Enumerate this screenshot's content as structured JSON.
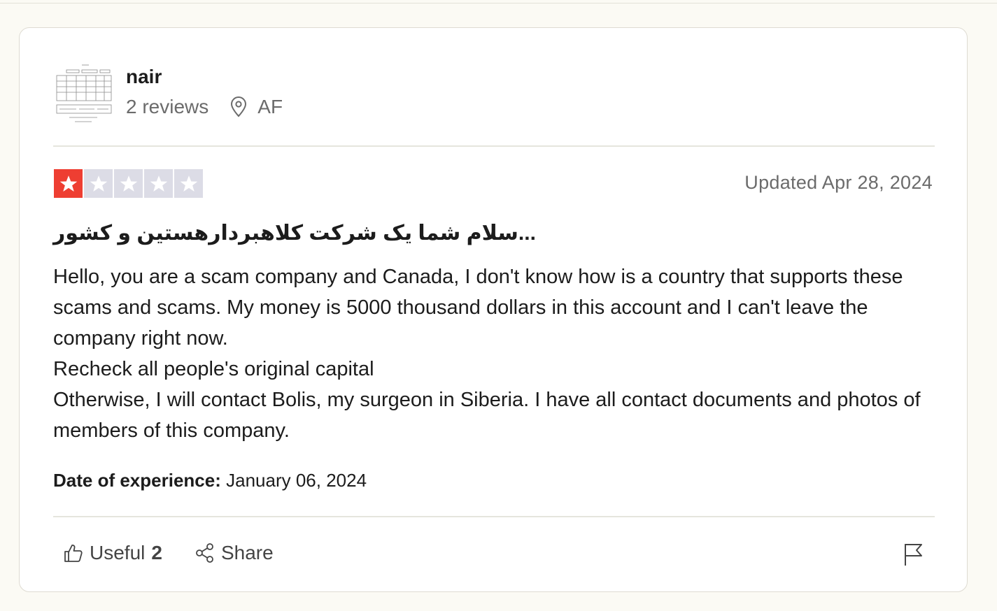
{
  "review": {
    "author": {
      "name": "nair",
      "reviews_count": "2 reviews",
      "country": "AF",
      "avatar": "avatar-thumbnail"
    },
    "rating": 1,
    "max_rating": 5,
    "updated": "Updated Apr 28, 2024",
    "title": "سلام شما یک شرکت کلاهبردارهستین و کشور...",
    "body": [
      "Hello, you are a scam company and Canada, I don't know how is a country that supports these scams and scams. My money is 5000 thousand dollars in this account and I can't leave the company right now.",
      "Recheck all people's original capital",
      "Otherwise, I will contact Bolis, my surgeon in Siberia. I have all contact documents and photos of members of this company."
    ],
    "experience_label": "Date of experience:",
    "experience_date": "January 06, 2024"
  },
  "actions": {
    "useful_label": "Useful",
    "useful_count": "2",
    "share_label": "Share"
  },
  "icons": {
    "location": "location-pin-icon",
    "useful": "thumbs-up-icon",
    "share": "share-icon",
    "report": "flag-icon",
    "star": "star-icon"
  },
  "colors": {
    "star_filled": "#ee3e32",
    "star_empty": "#dcdce6",
    "page_bg": "#fbfaf4"
  }
}
